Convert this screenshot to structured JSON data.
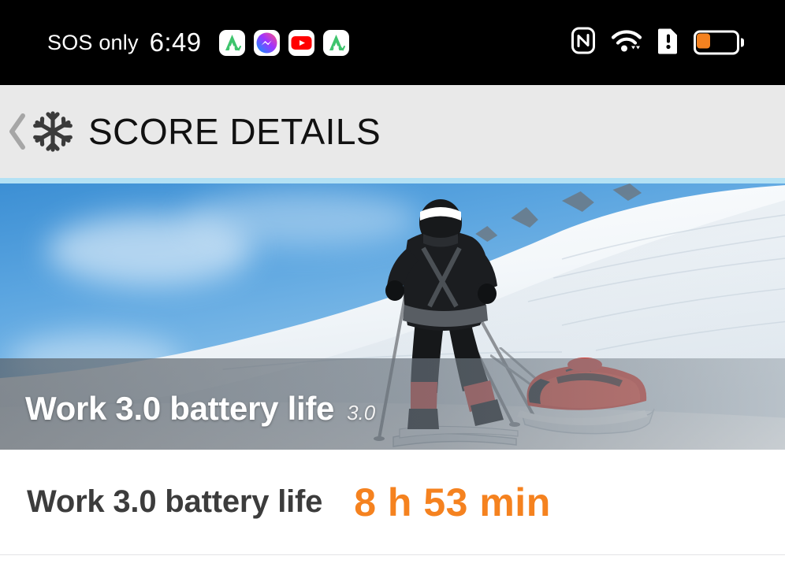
{
  "status_bar": {
    "carrier": "SOS only",
    "time": "6:49",
    "notification_icons": [
      "aptoide-icon",
      "messenger-icon",
      "youtube-icon",
      "aptoide-icon"
    ],
    "right_icons": [
      "nfc-icon",
      "wifi-icon",
      "sim-alert-icon",
      "battery-icon"
    ],
    "battery_level_percent": 25,
    "battery_color": "#f58220",
    "background": "#000000"
  },
  "header": {
    "back_label": "‹",
    "app_icon": "snowflake-icon",
    "title": "SCORE DETAILS",
    "background": "#e9e9e9",
    "accent_color": "#b3e1f4"
  },
  "hero": {
    "image_alt": "polar-skier-pulling-sled-photo",
    "overlay_title": "Work 3.0 battery life",
    "overlay_version": "3.0"
  },
  "result": {
    "label": "Work 3.0 battery life",
    "value": "8 h 53 min",
    "value_color": "#f5821f",
    "label_color": "#3c3c3c"
  }
}
